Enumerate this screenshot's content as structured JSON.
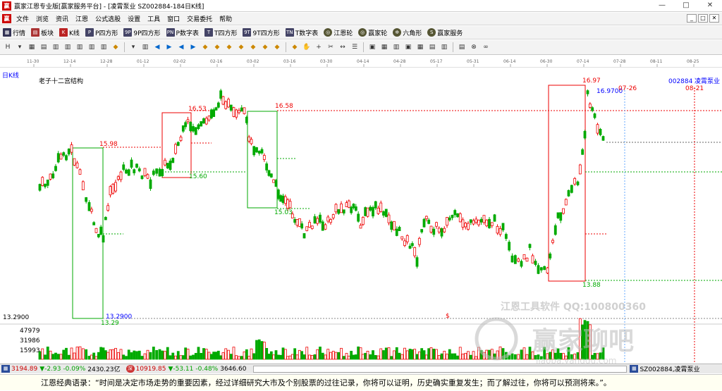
{
  "window": {
    "title": "赢家江恩专业版[赢家服务平台] - [凌霄泵业  SZ002884-184日K线]",
    "controls": [
      "—",
      "□",
      "✕"
    ],
    "mdi_controls": [
      "_",
      "□",
      "✕"
    ]
  },
  "menu": [
    "文件",
    "浏览",
    "资讯",
    "江恩",
    "公式选股",
    "设置",
    "工具",
    "窗口",
    "交易委托",
    "帮助"
  ],
  "toolbar1": [
    {
      "icon": "grid-icon",
      "label": "行情"
    },
    {
      "icon": "blocks-icon",
      "label": "板块"
    },
    {
      "icon": "kline-icon",
      "label": "K线"
    },
    {
      "icon": "p-square-icon",
      "label": "P四方形"
    },
    {
      "icon": "9p-square-icon",
      "label": "9P四方形"
    },
    {
      "icon": "pn-square-icon",
      "label": "P数字表"
    },
    {
      "icon": "t-square-icon",
      "label": "T四方形"
    },
    {
      "icon": "9t-square-icon",
      "label": "9T四方形"
    },
    {
      "icon": "tn-square-icon",
      "label": "T数字表"
    },
    {
      "icon": "gann-wheel-icon",
      "label": "江恩轮"
    },
    {
      "icon": "winner-wheel-icon",
      "label": "赢家轮"
    },
    {
      "icon": "hexagon-icon",
      "label": "六角形"
    },
    {
      "icon": "service-icon",
      "label": "赢家服务"
    }
  ],
  "toolbar2": [
    "H",
    "▾",
    "▦",
    "▤",
    "▥",
    "▥",
    "▥",
    "▥",
    "▥",
    "◆",
    "▾",
    "▥",
    "◀",
    "▶",
    "◀",
    "▶",
    "◆",
    "◆",
    "◆",
    "◆",
    "◆",
    "◆",
    "◆",
    "◆",
    "✋",
    "+",
    "✂",
    "↔",
    "☰",
    "▣",
    "▦",
    "▥",
    "▣",
    "▦",
    "▤",
    "▥",
    "▤",
    "⊗",
    "∞"
  ],
  "chart": {
    "period_label": "日K线",
    "indicator_title": "老子十二宫结构",
    "stock_code": "002884",
    "stock_name": "凌霄泵业",
    "dates": [
      "11-30",
      "12-14",
      "12-28",
      "01-12",
      "02-02",
      "02-16",
      "03-02",
      "03-16",
      "03-30",
      "04-14",
      "04-28",
      "05-17",
      "05-31",
      "06-14",
      "06-30",
      "07-14",
      "07-28",
      "08-11",
      "08-25"
    ],
    "price_labels": {
      "p1": "15.98",
      "p2": "16.53",
      "p3": "15.60",
      "p4": "16.58",
      "p5": "15.03",
      "p6": "13.2900",
      "p7": "13.29",
      "p8": "16.97",
      "p9": "16.9700",
      "p10": "13.88",
      "date1": "07-26",
      "date2": "08-21"
    },
    "y_axis_label": "13.2900",
    "volume_labels": [
      "47979",
      "31986",
      "15993"
    ],
    "dollar_mark": "$"
  },
  "watermark": {
    "line1": "江恩工具软件  QQ:100800360",
    "line2": "赢家聊吧",
    "line3": "jiaoba.yanggu.com"
  },
  "status": {
    "sh_index": "3194.89",
    "sh_change": "▼-2.93",
    "sh_pct": "-0.09%",
    "sh_amount": "2430.23亿",
    "sz_index": "10919.85",
    "sz_change": "▼-53.11",
    "sz_pct": "-0.48%",
    "sz_amount": "3646.60",
    "stock": "SZ002884,凌霄泵业",
    "colors": {
      "down": "#00a000",
      "up": "#e00000"
    }
  },
  "quote": "江恩经典语录：“时间是决定市场走势的重要因素，经过详细研究大市及个别股票的过往记录，你将可以证明，历史确实重复发生；而了解过往，你将可以预测将来。”。"
}
